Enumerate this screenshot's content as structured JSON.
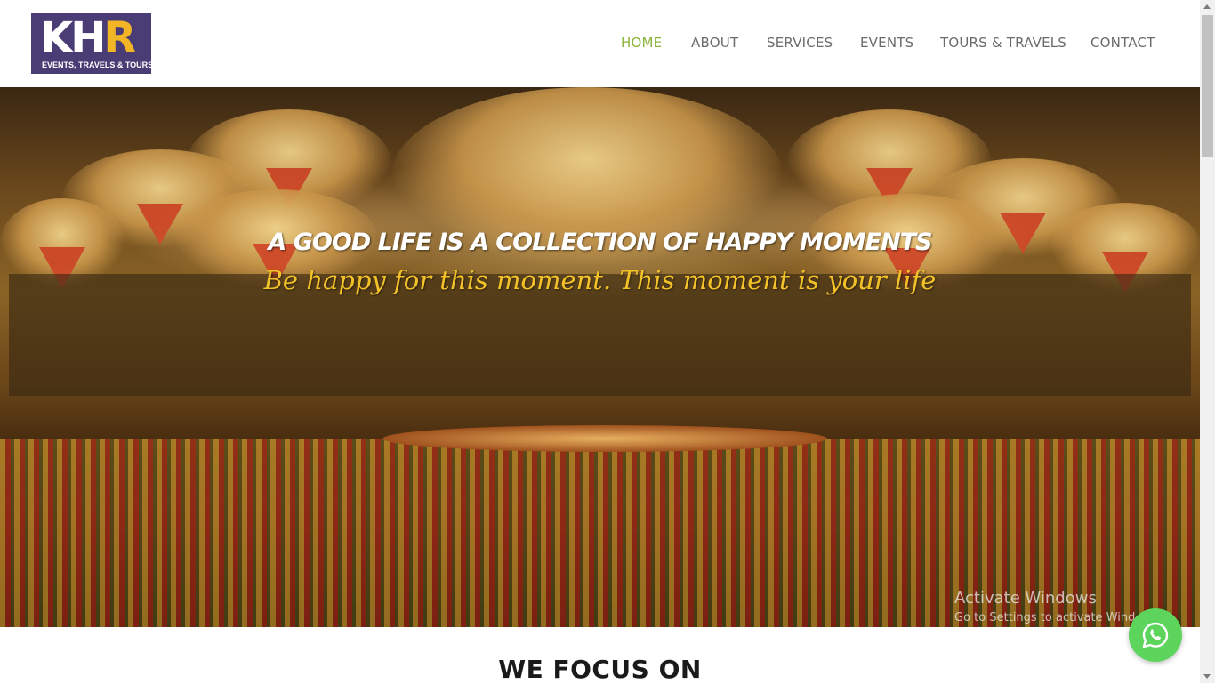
{
  "logo": {
    "letters_main": "KH",
    "letters_accent": "R",
    "tagline": "EVENTS, TRAVELS & TOURS"
  },
  "nav": {
    "items": [
      {
        "label": "HOME",
        "active": true
      },
      {
        "label": "ABOUT",
        "active": false
      },
      {
        "label": "SERVICES",
        "active": false
      },
      {
        "label": "EVENTS",
        "active": false
      },
      {
        "label": "TOURS & TRAVELS",
        "active": false
      },
      {
        "label": "CONTACT",
        "active": false
      }
    ]
  },
  "hero": {
    "headline": "A GOOD LIFE IS A COLLECTION OF HAPPY MOMENTS",
    "subline": "Be happy for this moment. This moment is your life"
  },
  "watermark": {
    "title": "Activate Windows",
    "subtitle": "Go to Settings to activate Wind"
  },
  "section": {
    "title": "WE FOCUS ON"
  },
  "whatsapp": {
    "icon": "whatsapp-icon"
  },
  "colors": {
    "nav_active": "#8ab339",
    "nav_default": "#6b6b6b",
    "subline": "#f3c229",
    "logo_bg": "#4a3d75",
    "logo_accent": "#f2b526",
    "whatsapp": "#5dd55d"
  }
}
